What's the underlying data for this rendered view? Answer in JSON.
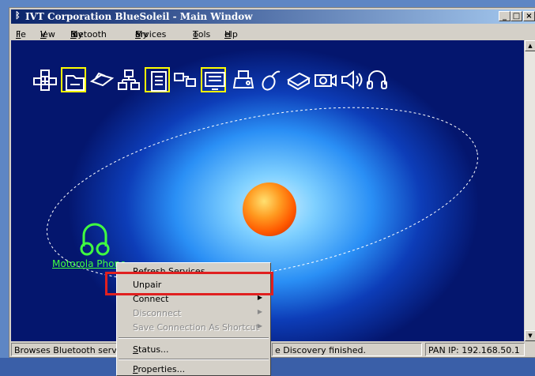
{
  "window": {
    "title": "IVT Corporation BlueSoleil - Main Window",
    "bluetooth_glyph": "ᛒ",
    "controls": {
      "minimize": "_",
      "maximize": "□",
      "close": "×"
    }
  },
  "menu": {
    "file": {
      "mnemonic": "F",
      "rest": "ile"
    },
    "view": {
      "mnemonic": "V",
      "rest": "iew"
    },
    "my_bluetooth": {
      "before": "My ",
      "mnemonic": "B",
      "rest": "luetooth"
    },
    "my_services": {
      "before": "My ",
      "mnemonic": "S",
      "rest": "ervices"
    },
    "tools": {
      "mnemonic": "T",
      "rest": "ools"
    },
    "help": {
      "mnemonic": "H",
      "rest": "elp"
    }
  },
  "service_icons": [
    "network-icon",
    "file-transfer-icon",
    "dialup-icon",
    "lan-icon",
    "serial-port-icon",
    "personal-network-icon",
    "sync-icon",
    "fax-icon",
    "mouse-icon",
    "printer-icon",
    "camera-icon",
    "audio-icon",
    "headset-icon"
  ],
  "device": {
    "label": "Motorola Phone",
    "icon": "headset-icon",
    "color": "#40ff40"
  },
  "context_menu": {
    "refresh_services": "Refresh Services",
    "unpair": "Unpair",
    "connect": "Connect",
    "disconnect": "Disconnect",
    "save_shortcut": "Save Connection As Shortcut",
    "status": {
      "mnemonic": "S",
      "rest": "tatus..."
    },
    "properties": {
      "mnemonic": "P",
      "rest": "roperties..."
    }
  },
  "statusbar": {
    "left": "Browses Bluetooth servic",
    "middle": "e Discovery finished.",
    "right": "PAN IP: 192.168.50.1"
  },
  "colors": {
    "highlight_box": "#e02020",
    "title_start": "#0a246a",
    "sun": "#ff7a00"
  }
}
